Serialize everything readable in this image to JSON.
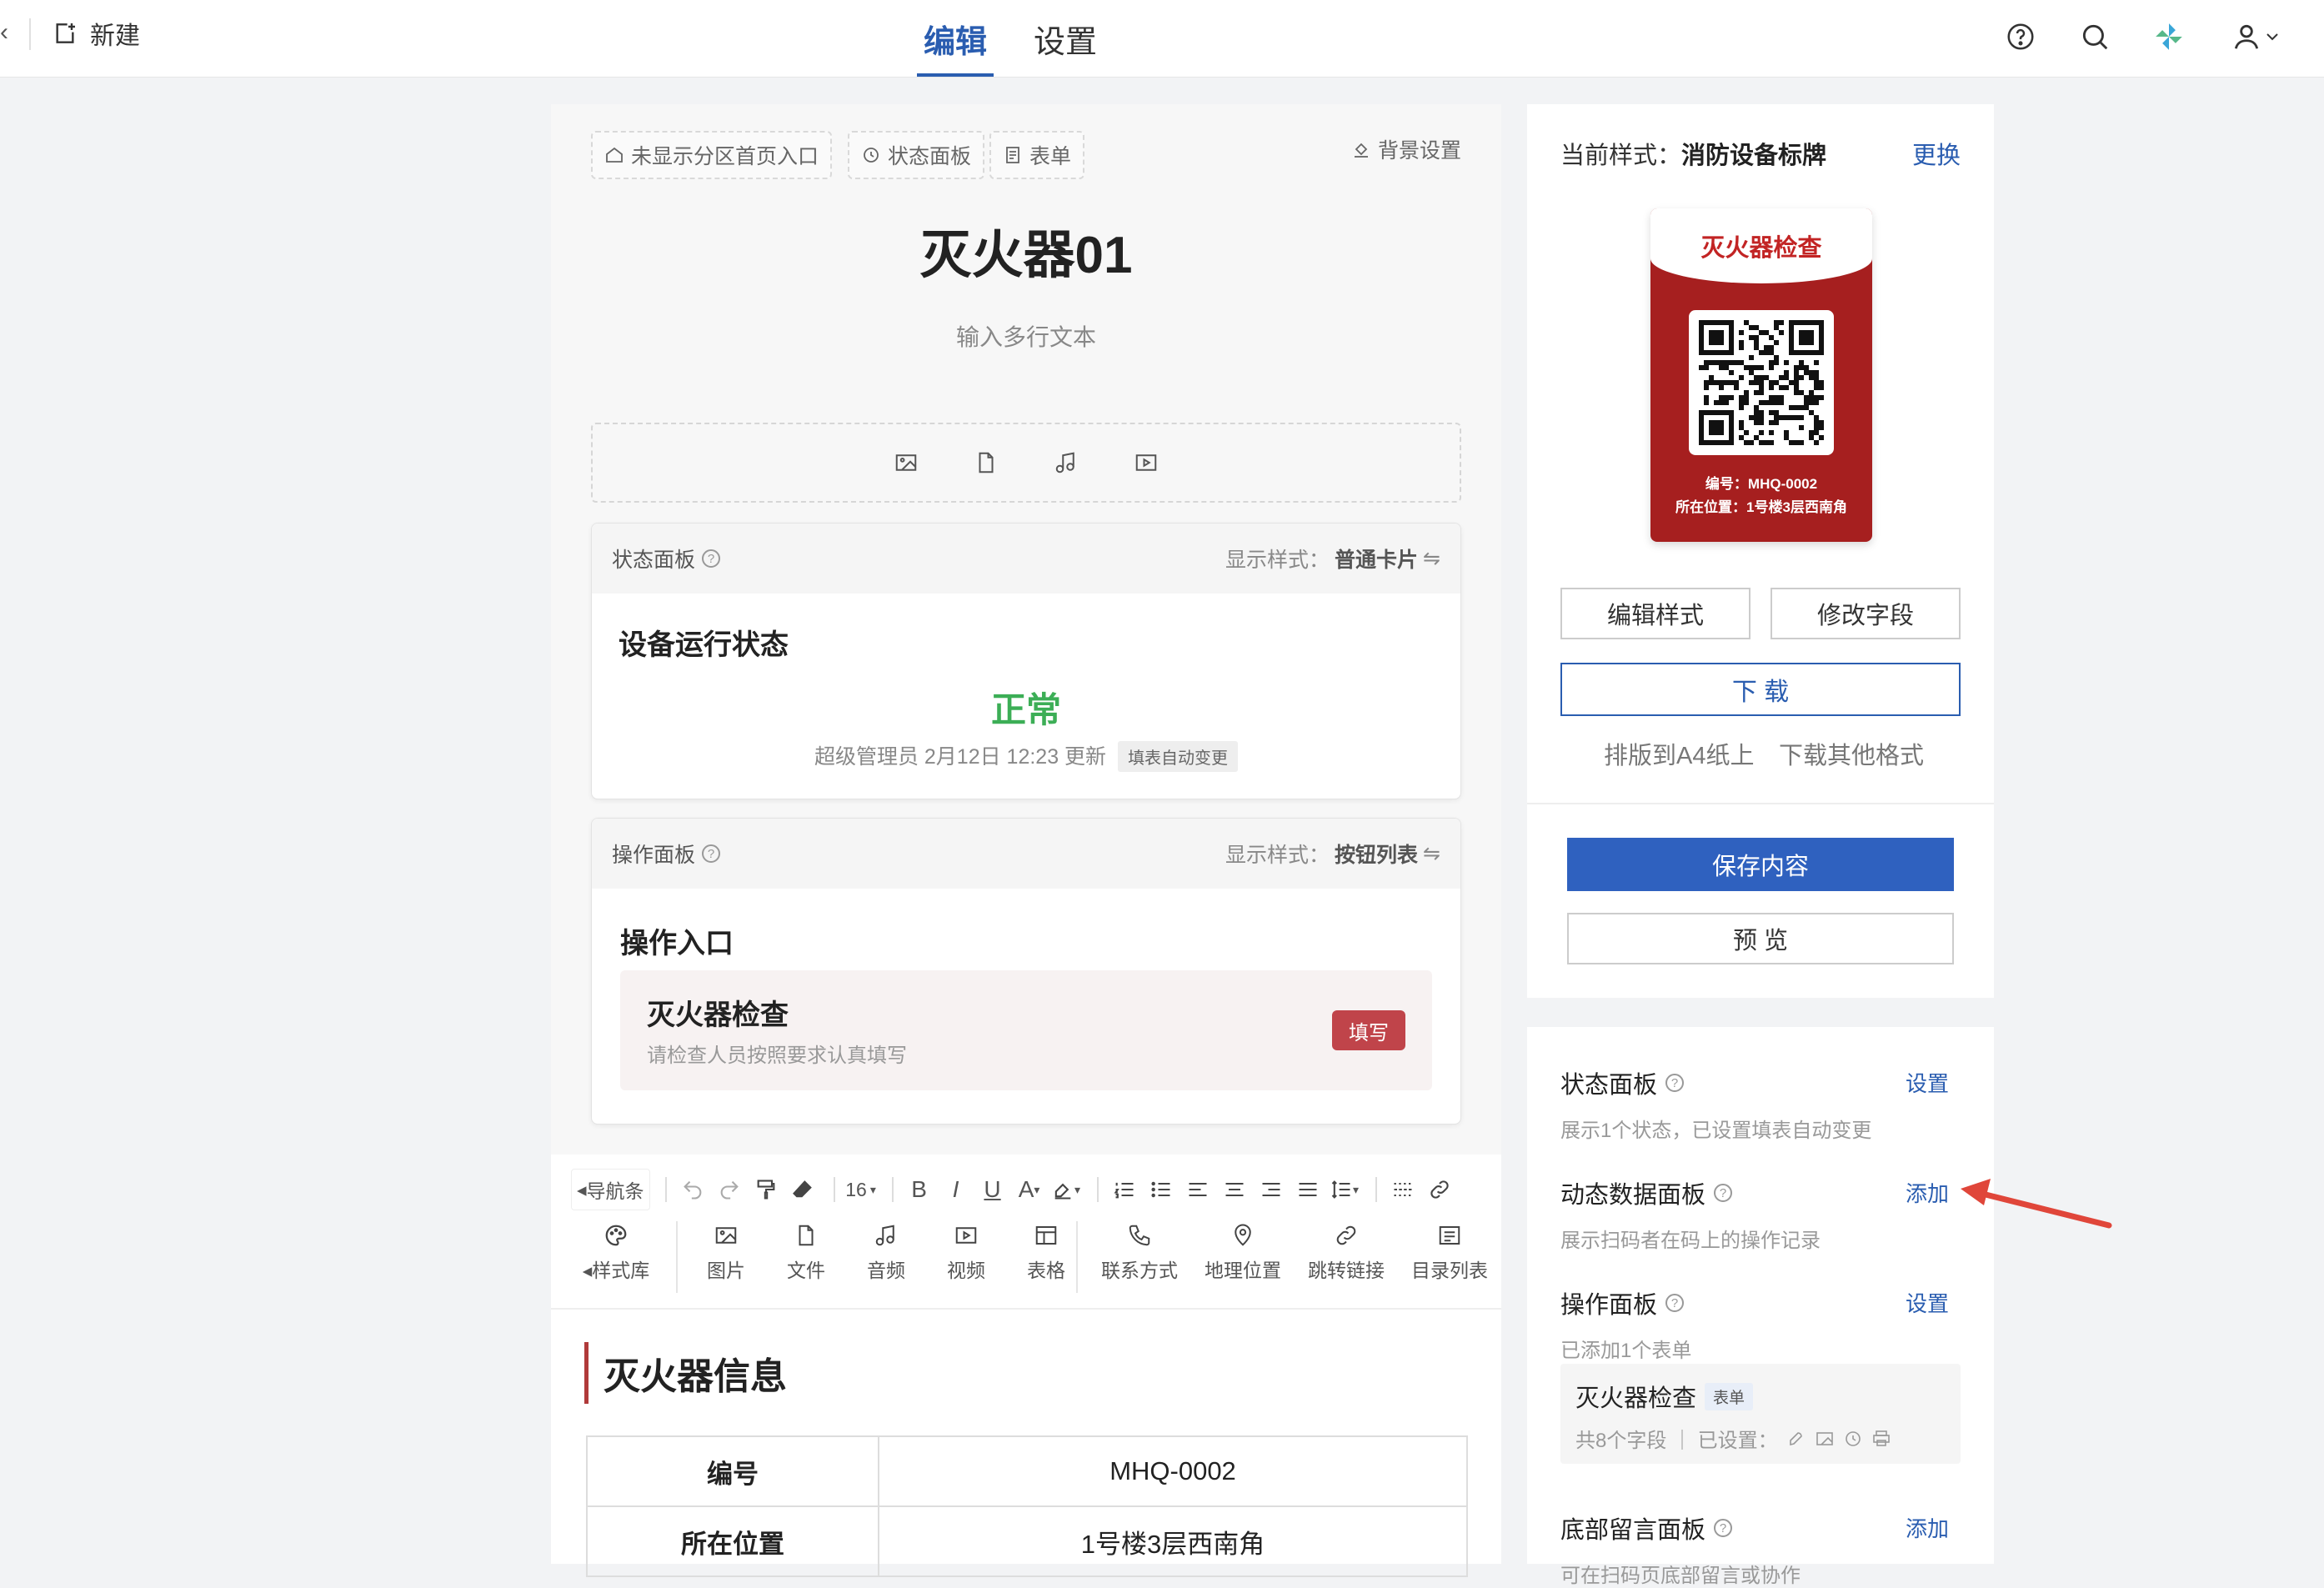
{
  "header": {
    "new_label": "新建",
    "tabs": [
      {
        "label": "编辑",
        "active": true
      },
      {
        "label": "设置",
        "active": false
      }
    ],
    "icons": [
      "help-icon",
      "search-icon",
      "pinwheel-icon",
      "user-icon",
      "chevron-down-icon"
    ],
    "accent": "#2a5db0"
  },
  "editor": {
    "chips": [
      "未显示分区首页入口",
      "状态面板",
      "表单"
    ],
    "bg_setting": "背景设置",
    "title": "灭火器01",
    "subtitle": "输入多行文本",
    "status_panel": {
      "label": "状态面板",
      "style_label": "显示样式：",
      "style_value": "普通卡片",
      "heading": "设备运行状态",
      "value": "正常",
      "value_color": "#3cae56",
      "meta": "超级管理员 2月12日 12:23 更新",
      "tag": "填表自动变更"
    },
    "op_panel": {
      "label": "操作面板",
      "style_label": "显示样式：",
      "style_value": "按钮列表",
      "heading": "操作入口",
      "card_title": "灭火器检查",
      "card_desc": "请检查人员按照要求认真填写",
      "fill_button": "填写"
    },
    "toolbar": {
      "nav": "导航条",
      "font_size": "16",
      "style_lib": "样式库",
      "insert": [
        "图片",
        "文件",
        "音频",
        "视频",
        "表格",
        "联系方式",
        "地理位置",
        "跳转链接",
        "目录列表"
      ]
    },
    "info": {
      "title": "灭火器信息",
      "rows": [
        {
          "key": "编号",
          "value": "MHQ-0002"
        },
        {
          "key": "所在位置",
          "value": "1号楼3层西南角"
        }
      ]
    }
  },
  "style_panel": {
    "current_label": "当前样式：",
    "current_value": "消防设备标牌",
    "change": "更换",
    "label_card": {
      "title": "灭火器检查",
      "line1": "编号：MHQ-0002",
      "line2": "所在位置：1号楼3层西南角",
      "color": "#a61f1f"
    },
    "edit_style": "编辑样式",
    "edit_fields": "修改字段",
    "download": "下 载",
    "a4": "排版到A4纸上",
    "other_formats": "下载其他格式",
    "save": "保存内容",
    "preview": "预 览"
  },
  "settings": {
    "status": {
      "title": "状态面板",
      "desc": "展示1个状态，已设置填表自动变更",
      "action": "设置"
    },
    "dynamic": {
      "title": "动态数据面板",
      "desc": "展示扫码者在码上的操作记录",
      "action": "添加"
    },
    "op": {
      "title": "操作面板",
      "desc": "已添加1个表单",
      "action": "设置"
    },
    "form": {
      "name": "灭火器检查",
      "tag": "表单",
      "meta": "共8个字段 ｜ 已设置："
    },
    "bottom": {
      "title": "底部留言面板",
      "desc": "可在扫码页底部留言或协作",
      "action": "添加"
    }
  }
}
